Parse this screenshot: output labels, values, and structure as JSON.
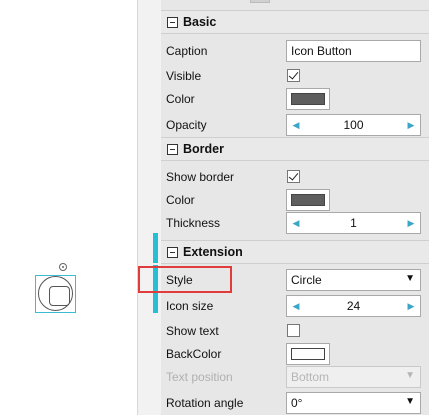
{
  "colors": {
    "accent": "#27bfd6",
    "highlight": "#e03c3c",
    "color_swatch": "#5e5e5e",
    "border_color_swatch": "#5e5e5e",
    "back_color_swatch": "#ffffff"
  },
  "icons": {
    "collapse": "minus-box-icon",
    "check": "checkmark-icon",
    "spin_left": "triangle-left-icon",
    "spin_right": "triangle-right-icon",
    "dropdown": "triangle-down-icon",
    "rotate_handle": "rotate-handle-icon"
  },
  "sections": {
    "basic": {
      "title": "Basic",
      "caption_label": "Caption",
      "caption_value": "Icon Button",
      "visible_label": "Visible",
      "visible_checked": true,
      "color_label": "Color",
      "opacity_label": "Opacity",
      "opacity_value": "100"
    },
    "border": {
      "title": "Border",
      "show_border_label": "Show border",
      "show_border_checked": true,
      "color_label": "Color",
      "thickness_label": "Thickness",
      "thickness_value": "1"
    },
    "extension": {
      "title": "Extension",
      "style_label": "Style",
      "style_value": "Circle",
      "icon_size_label": "Icon size",
      "icon_size_value": "24",
      "show_text_label": "Show text",
      "show_text_checked": false,
      "backcolor_label": "BackColor",
      "text_position_label": "Text position",
      "text_position_value": "Bottom",
      "rotation_label": "Rotation angle",
      "rotation_value": "0°"
    }
  },
  "glyphs": {
    "spin_left": "◀",
    "spin_right": "▶",
    "dropdown": "▼"
  }
}
